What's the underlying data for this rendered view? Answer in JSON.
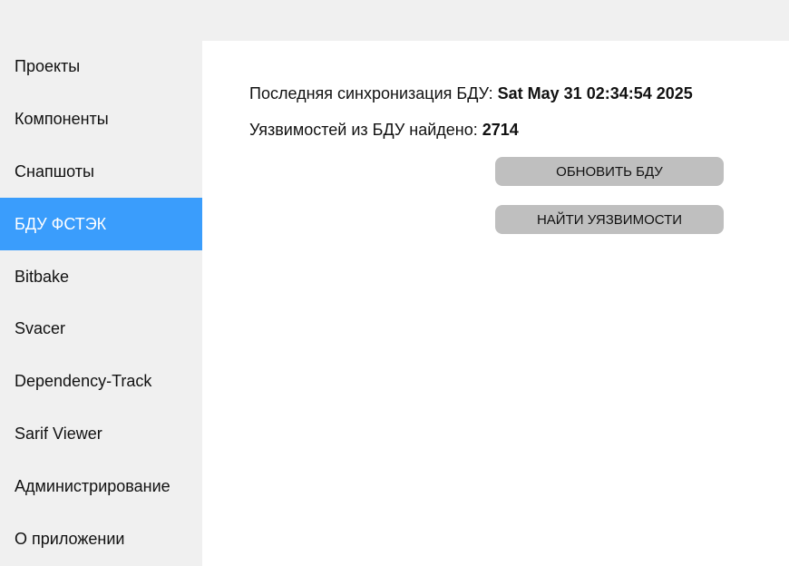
{
  "sidebar": {
    "items": [
      {
        "label": "Проекты"
      },
      {
        "label": "Компоненты"
      },
      {
        "label": "Снапшоты"
      },
      {
        "label": "БДУ ФСТЭК"
      },
      {
        "label": "Bitbake"
      },
      {
        "label": "Svacer"
      },
      {
        "label": "Dependency-Track"
      },
      {
        "label": "Sarif Viewer"
      },
      {
        "label": "Администрирование"
      },
      {
        "label": "О приложении"
      }
    ],
    "active_index": 3
  },
  "main": {
    "sync_label": "Последняя синхронизация БДУ: ",
    "sync_value": "Sat May 31 02:34:54 2025",
    "found_label": "Уязвимостей из БДУ найдено: ",
    "found_value": "2714",
    "update_button": "ОБНОВИТЬ БДУ",
    "find_button": "НАЙТИ УЯЗВИМОСТИ"
  },
  "colors": {
    "active_nav": "#3a9dfc",
    "sidebar_bg": "#f0f0f0",
    "button_bg": "#bfbfbf"
  }
}
